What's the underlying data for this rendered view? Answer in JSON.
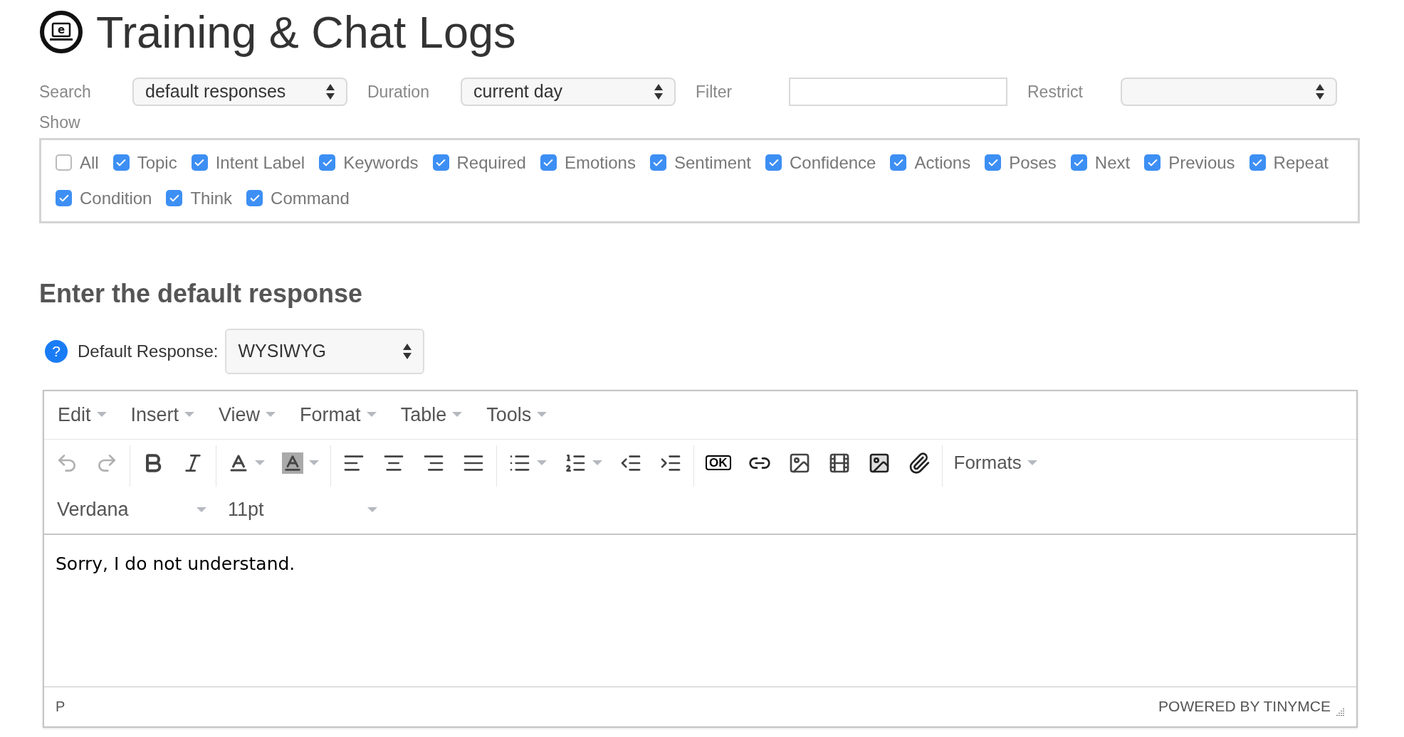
{
  "header": {
    "logo_letter": "e",
    "title": "Training & Chat Logs"
  },
  "filters": [
    {
      "label": "Search",
      "kind": "select",
      "value": "default responses"
    },
    {
      "label": "Duration",
      "kind": "select",
      "value": "current day"
    },
    {
      "label": "Filter",
      "kind": "input"
    },
    {
      "label": "Restrict",
      "kind": "select"
    }
  ],
  "show": {
    "label": "Show",
    "options": [
      {
        "label": "All",
        "checked": false
      },
      {
        "label": "Topic",
        "checked": true
      },
      {
        "label": "Intent Label",
        "checked": true
      },
      {
        "label": "Keywords",
        "checked": true
      },
      {
        "label": "Required",
        "checked": true
      },
      {
        "label": "Emotions",
        "checked": true
      },
      {
        "label": "Sentiment",
        "checked": true
      },
      {
        "label": "Confidence",
        "checked": true
      },
      {
        "label": "Actions",
        "checked": true
      },
      {
        "label": "Poses",
        "checked": true
      },
      {
        "label": "Next",
        "checked": true
      },
      {
        "label": "Previous",
        "checked": true
      },
      {
        "label": "Repeat",
        "checked": true
      },
      {
        "label": "Condition",
        "checked": true
      },
      {
        "label": "Think",
        "checked": true
      },
      {
        "label": "Command",
        "checked": true
      }
    ]
  },
  "section_heading": "Enter the default response",
  "default_response": {
    "help": "?",
    "label": "Default Response:",
    "value": "WYSIWYG"
  },
  "editor": {
    "menu": [
      "Edit",
      "Insert",
      "View",
      "Format",
      "Table",
      "Tools"
    ],
    "toolbar": [
      {
        "kind": "undo",
        "disabled": true
      },
      {
        "kind": "redo",
        "disabled": true
      },
      {
        "kind": "sep"
      },
      {
        "kind": "bold",
        "disabled": false
      },
      {
        "kind": "italic",
        "disabled": false
      },
      {
        "kind": "sep"
      },
      {
        "kind": "forecolor",
        "disabled": false
      },
      {
        "kind": "backcolor",
        "disabled": false
      },
      {
        "kind": "sep"
      },
      {
        "kind": "alignleft",
        "disabled": false
      },
      {
        "kind": "aligncenter",
        "disabled": false
      },
      {
        "kind": "alignright",
        "disabled": false
      },
      {
        "kind": "alignjustify",
        "disabled": false
      },
      {
        "kind": "sep"
      },
      {
        "kind": "bullist",
        "disabled": false
      },
      {
        "kind": "numlist",
        "disabled": false
      },
      {
        "kind": "outdent",
        "disabled": false
      },
      {
        "kind": "indent",
        "disabled": false
      },
      {
        "kind": "sep"
      },
      {
        "kind": "ok",
        "label": "OK",
        "disabled": false
      },
      {
        "kind": "link",
        "disabled": false
      },
      {
        "kind": "image",
        "disabled": false
      },
      {
        "kind": "media",
        "disabled": false
      },
      {
        "kind": "photo",
        "disabled": false
      },
      {
        "kind": "attach",
        "disabled": false
      },
      {
        "kind": "sep"
      },
      {
        "kind": "formats",
        "label": "Formats",
        "disabled": false
      }
    ],
    "font_family": "Verdana",
    "font_size": "11pt",
    "content": "Sorry, I do not understand.",
    "path": "P",
    "branding": "POWERED BY TINYMCE"
  }
}
